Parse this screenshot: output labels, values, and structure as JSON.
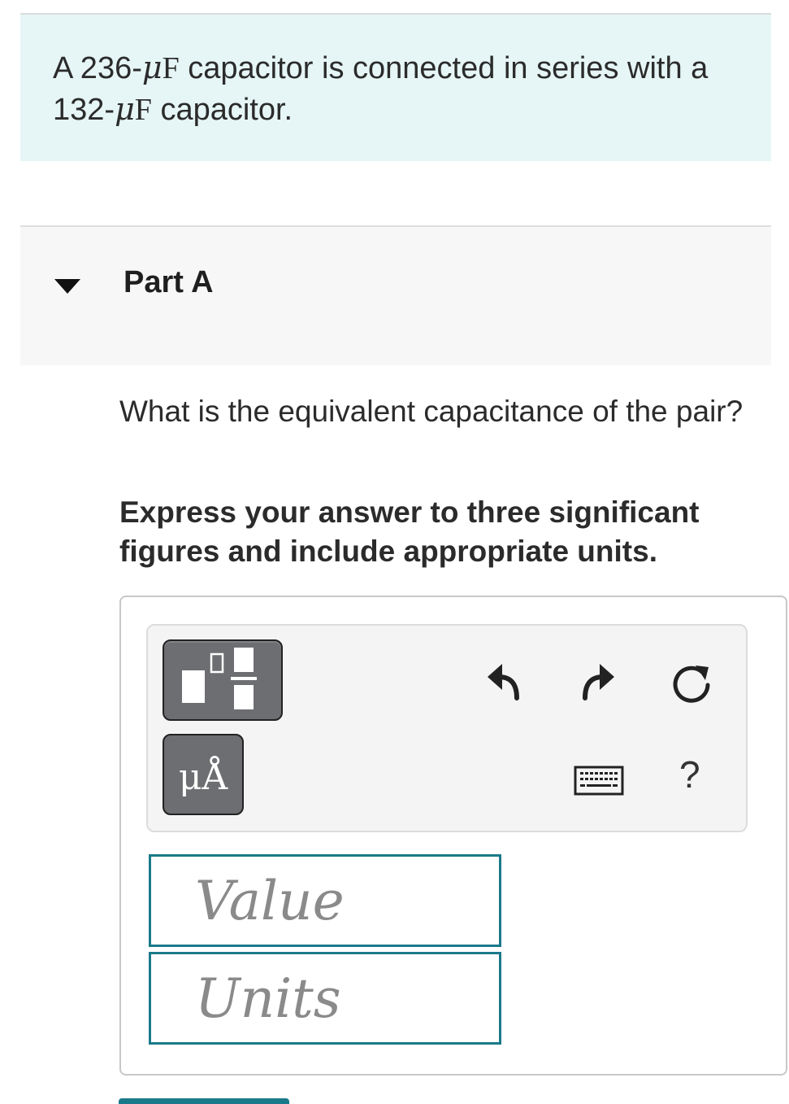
{
  "intro": {
    "prefix": "A 236-",
    "mu": "μ",
    "unit": "F",
    "middle": " capacitor is connected in series with a 132-",
    "suffix": " capacitor."
  },
  "part": {
    "title": "Part A",
    "toggle_icon": "caret-down-icon"
  },
  "question": {
    "text": "What is the equivalent capacitance of the pair?",
    "instruction": "Express your answer to three significant figures and include appropriate units."
  },
  "toolbar": {
    "template_icon": "fraction-template-icon",
    "units_label": "μÅ",
    "undo_icon": "undo-icon",
    "redo_icon": "redo-icon",
    "reset_icon": "reset-icon",
    "keyboard_icon": "keyboard-icon",
    "help_label": "?"
  },
  "answer": {
    "value_placeholder": "Value",
    "units_placeholder": "Units"
  },
  "colors": {
    "intro_bg": "#e6f5f5",
    "accent": "#1a7a8a",
    "button_gray": "#6d6e71"
  }
}
